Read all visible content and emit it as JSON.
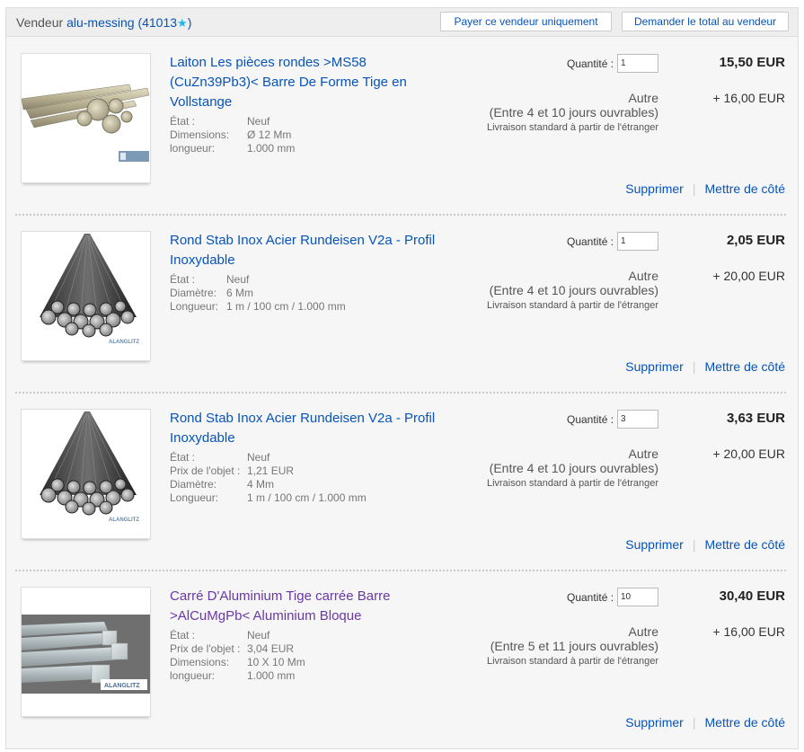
{
  "seller": {
    "label": "Vendeur",
    "name": "alu-messing",
    "feedback": "(41013",
    "feedback_close": ")",
    "pay_only_label": "Payer ce vendeur uniquement",
    "request_total_label": "Demander le total au vendeur"
  },
  "common": {
    "qty_label": "Quantité :",
    "remove_label": "Supprimer",
    "save_label": "Mettre de côté",
    "shipping_std": "Livraison standard à partir de l'étranger",
    "shipping_type": "Autre"
  },
  "items": [
    {
      "title": "Laiton Les pièces rondes >MS58 (CuZn39Pb3)< Barre De Forme Tige en Vollstange",
      "specs": [
        {
          "k": "État :",
          "v": "Neuf"
        },
        {
          "k": "Dimensions:",
          "v": "Ø 12 Mm"
        },
        {
          "k": "longueur:",
          "v": "1.000 mm"
        }
      ],
      "qty": "1",
      "price": "15,50 EUR",
      "shipping_cost": "+ 16,00 EUR",
      "shipping_time": "(Entre 4 et 10 jours ouvrables)",
      "image": "brass-rods"
    },
    {
      "title": "Rond Stab Inox Acier Rundeisen V2a - Profil Inoxydable",
      "specs": [
        {
          "k": "État :",
          "v": "Neuf"
        },
        {
          "k": "Diamètre:",
          "v": "6 Mm"
        },
        {
          "k": "Longueur:",
          "v": "1 m / 100 cm / 1.000 mm"
        }
      ],
      "qty": "1",
      "price": "2,05 EUR",
      "shipping_cost": "+ 20,00 EUR",
      "shipping_time": "(Entre 4 et 10 jours ouvrables)",
      "image": "steel-rods"
    },
    {
      "title": "Rond Stab Inox Acier Rundeisen V2a - Profil Inoxydable",
      "specs": [
        {
          "k": "État :",
          "v": "Neuf"
        },
        {
          "k": "Prix de l'objet :",
          "v": "1,21 EUR"
        },
        {
          "k": "Diamètre:",
          "v": "4 Mm"
        },
        {
          "k": "Longueur:",
          "v": "1 m / 100 cm / 1.000 mm"
        }
      ],
      "qty": "3",
      "price": "3,63 EUR",
      "shipping_cost": "+ 20,00 EUR",
      "shipping_time": "(Entre 4 et 10 jours ouvrables)",
      "image": "steel-rods"
    },
    {
      "title": "Carré D'Aluminium Tige carrée Barre >AlCuMgPb< Aluminium Bloque",
      "specs": [
        {
          "k": "État :",
          "v": "Neuf"
        },
        {
          "k": "Prix de l'objet :",
          "v": "3,04 EUR"
        },
        {
          "k": "Dimensions:",
          "v": "10 X 10 Mm"
        },
        {
          "k": "longueur:",
          "v": "1.000 mm"
        }
      ],
      "qty": "10",
      "price": "30,40 EUR",
      "shipping_cost": "+ 16,00 EUR",
      "shipping_time": "(Entre 5 et 11 jours ouvrables)",
      "image": "aluminium-bars"
    }
  ],
  "watermarks": {
    "steel": "ALANGLITZ",
    "aluminium": "ALANGLITZ"
  }
}
